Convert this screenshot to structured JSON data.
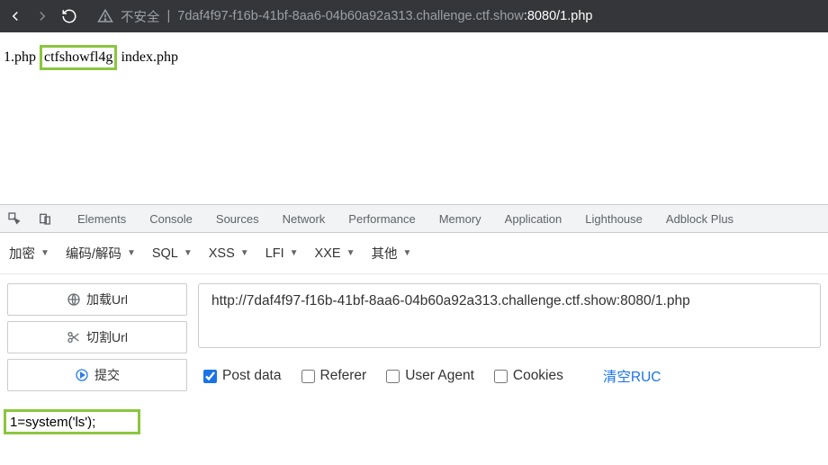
{
  "nav": {
    "insecure_label": "不安全",
    "url_host": "7daf4f97-f16b-41bf-8aa6-04b60a92a313.challenge.ctf.show",
    "url_port": ":8080",
    "url_path": "/1.php"
  },
  "page": {
    "text_before": "1.php ",
    "highlighted": "ctfshowfl4g",
    "text_after": " index.php"
  },
  "devtools": {
    "tabs": [
      "Elements",
      "Console",
      "Sources",
      "Network",
      "Performance",
      "Memory",
      "Application",
      "Lighthouse",
      "Adblock Plus"
    ]
  },
  "ext_toolbar": {
    "items": [
      "加密",
      "编码/解码",
      "SQL",
      "XSS",
      "LFI",
      "XXE",
      "其他"
    ]
  },
  "buttons": {
    "load": "加载Url",
    "split": "切割Url",
    "submit": "提交"
  },
  "url_value": "http://7daf4f97-f16b-41bf-8aa6-04b60a92a313.challenge.ctf.show:8080/1.php",
  "checks": {
    "post": "Post data",
    "referer": "Referer",
    "ua": "User Agent",
    "cookies": "Cookies",
    "clear": "清空RUC"
  },
  "payload": "1=system('ls');"
}
